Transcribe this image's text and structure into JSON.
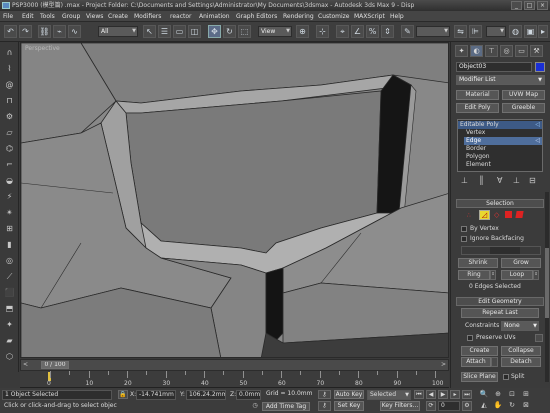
{
  "window": {
    "title": "PSP3000 (模型篇) .max  - Project Folder: C:\\Documents and Settings\\Administrator\\My Documents\\3dsmax   - Autodesk 3ds Max 9   - Disp",
    "controls": [
      "_",
      "□",
      "×"
    ]
  },
  "menu": [
    "File",
    "Edit",
    "Tools",
    "Group",
    "Views",
    "Create",
    "Modifiers",
    "reactor",
    "Animation",
    "Graph Editors",
    "Rendering",
    "Customize",
    "MAXScript",
    "Help"
  ],
  "toolbar": {
    "selection_filter": "All",
    "reference_coord": "View",
    "named_selection": ""
  },
  "viewport": {
    "label": "Perspective"
  },
  "timeline": {
    "frame_counter": "0 / 100",
    "ticks": [
      "0",
      "10",
      "20",
      "30",
      "40",
      "50",
      "60",
      "70",
      "80",
      "90",
      "100"
    ]
  },
  "status": {
    "selected": "1 Object Selected",
    "prompt": "Click or click-and-drag to select objects",
    "x_label": "X:",
    "x_value": "-14.741mm",
    "y_label": "Y:",
    "y_value": "106.24.2mm",
    "z_label": "Z:",
    "z_value": "0.0mm",
    "grid": "Grid = 10.0mm",
    "add_time_tag": "Add Time Tag",
    "auto_key": "Auto Key",
    "set_key": "Set Key",
    "key_mode": "Selected",
    "key_filters": "Key Filters...",
    "frame": "0"
  },
  "command_panel": {
    "object_name": "Object03",
    "object_color": "#1a2fd6",
    "modifier_list": "Modifier List",
    "buttons": {
      "material": "Material",
      "uvw_map": "UVW Map",
      "edit_poly": "Edit Poly",
      "greeble": "Greeble"
    },
    "stack": [
      {
        "label": "Editable Poly",
        "selected": false
      },
      {
        "label": "Vertex",
        "selected": false
      },
      {
        "label": "Edge",
        "selected": true
      },
      {
        "label": "Border",
        "selected": false
      },
      {
        "label": "Polygon",
        "selected": false
      },
      {
        "label": "Element",
        "selected": false
      }
    ],
    "selection": {
      "header": "Selection",
      "by_vertex": "By Vertex",
      "ignore_backfacing": "Ignore Backfacing",
      "shrink": "Shrink",
      "grow": "Grow",
      "ring": "Ring",
      "loop": "Loop",
      "status": "0 Edges Selected"
    },
    "edit_geometry": {
      "header": "Edit Geometry",
      "repeat_last": "Repeat Last",
      "constraints_label": "Constraints",
      "constraints_value": "None",
      "preserve_uvs": "Preserve UVs",
      "create": "Create",
      "collapse": "Collapse",
      "attach": "Attach",
      "detach": "Detach",
      "slice_plane": "Slice Plane",
      "split": "Split"
    }
  }
}
